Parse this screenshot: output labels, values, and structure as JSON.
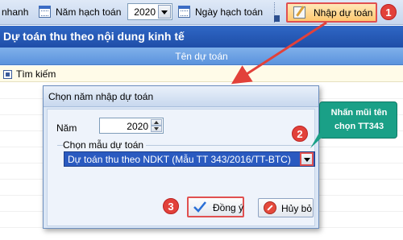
{
  "toolbar": {
    "left_fragment": "nhanh",
    "year_label": "Năm hạch toán",
    "year_value": "2020",
    "date_label": "Ngày hạch toán",
    "import_button": "Nhập dự toán"
  },
  "main": {
    "title": "Dự toán thu theo nội dung kinh tế",
    "column_header": "Tên dự toán",
    "search_label": "Tìm kiếm"
  },
  "dialog": {
    "title": "Chọn năm nhập dự toán",
    "year_label": "Năm",
    "year_value": "2020",
    "template_label": "Chọn mẫu dự toán",
    "template_value": "Dự toán thu theo NDKT (Mẫu TT 343/2016/TT-BTC)",
    "ok_button": "Đồng ý",
    "cancel_button": "Hủy bỏ"
  },
  "annotations": {
    "step1": "1",
    "step2": "2",
    "step3": "3",
    "callout_line1": "Nhấn mũi tên",
    "callout_line2": "chọn TT343",
    "highlight_color": "#e05050",
    "callout_color": "#1aa087"
  }
}
